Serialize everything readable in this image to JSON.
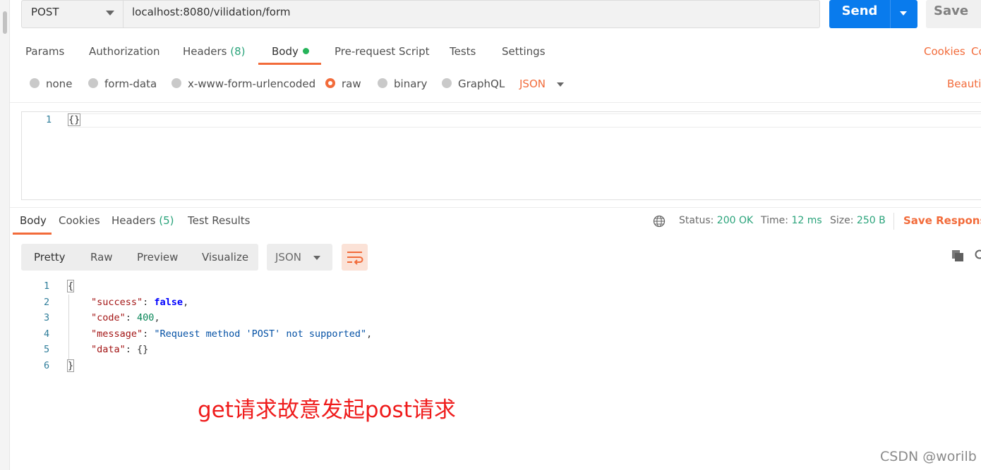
{
  "request": {
    "method": "POST",
    "url": "localhost:8080/vilidation/form",
    "send_label": "Send",
    "save_label": "Save"
  },
  "request_tabs": [
    {
      "label": "Params"
    },
    {
      "label": "Authorization"
    },
    {
      "label": "Headers",
      "count": "(8)"
    },
    {
      "label": "Body",
      "active": true,
      "indicator": "green-dot"
    },
    {
      "label": "Pre-request Script"
    },
    {
      "label": "Tests"
    },
    {
      "label": "Settings"
    }
  ],
  "request_links": {
    "cookies": "Cookies",
    "code": "Co",
    "beautify": "Beautif"
  },
  "body_types": [
    {
      "label": "none",
      "selected": false
    },
    {
      "label": "form-data",
      "selected": false
    },
    {
      "label": "x-www-form-urlencoded",
      "selected": false
    },
    {
      "label": "raw",
      "selected": true
    },
    {
      "label": "binary",
      "selected": false
    },
    {
      "label": "GraphQL",
      "selected": false
    }
  ],
  "body_format": "JSON",
  "request_editor": {
    "line_number": "1",
    "content": "{}"
  },
  "response_tabs": [
    {
      "label": "Body",
      "active": true
    },
    {
      "label": "Cookies"
    },
    {
      "label": "Headers",
      "count": "(5)"
    },
    {
      "label": "Test Results"
    }
  ],
  "response_status": {
    "status_label": "Status:",
    "status_value": "200 OK",
    "time_label": "Time:",
    "time_value": "12 ms",
    "size_label": "Size:",
    "size_value": "250 B",
    "save_response": "Save Response"
  },
  "view_modes": [
    "Pretty",
    "Raw",
    "Preview",
    "Visualize"
  ],
  "response_format": "JSON",
  "response_body": {
    "line_numbers": [
      "1",
      "2",
      "3",
      "4",
      "5",
      "6"
    ],
    "open": "{",
    "success_key": "\"success\"",
    "success_value": "false",
    "code_key": "\"code\"",
    "code_value": "400",
    "message_key": "\"message\"",
    "message_value": "\"Request method 'POST' not supported\"",
    "data_key": "\"data\"",
    "data_value": "{}",
    "close": "}"
  },
  "annotation": "get请求故意发起post请求",
  "watermark": "CSDN @worilb",
  "colors": {
    "accent": "#f26b3a",
    "send": "#097bed",
    "success": "#29a37a",
    "annotation": "#ef1c1c"
  }
}
